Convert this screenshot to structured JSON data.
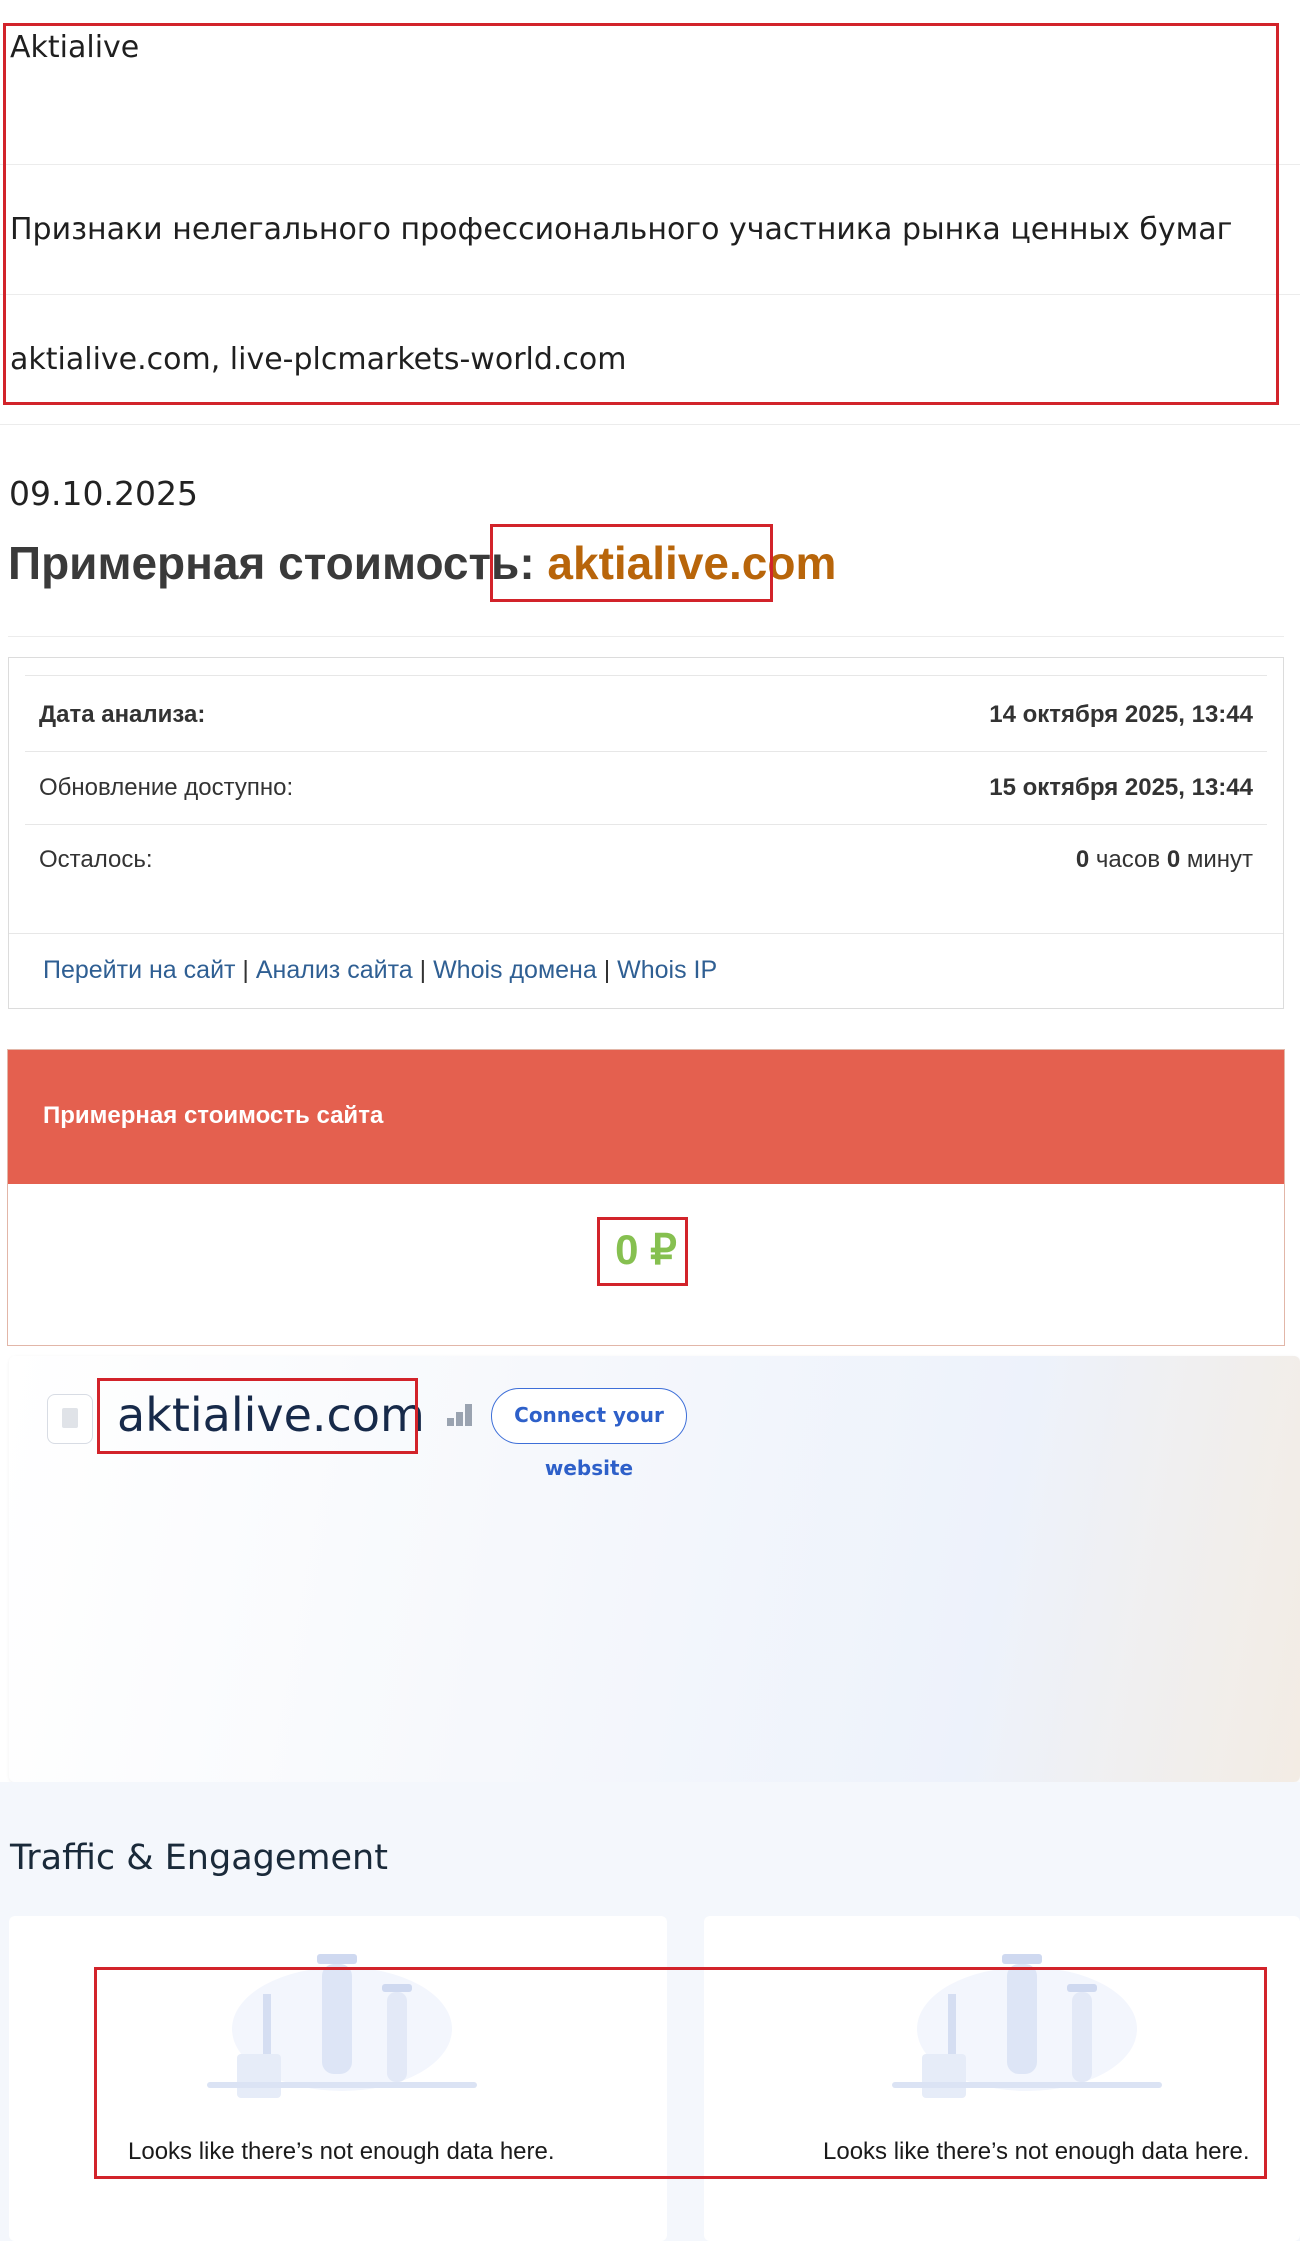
{
  "header": {
    "name": "Aktialive",
    "description": "Признаки нелегального профессионального участника рынка ценных бумаг",
    "domains": "aktialive.com, live-plcmarkets-world.com"
  },
  "date": "09.10.2025",
  "title": {
    "prefix": "Примерная стоимость: ",
    "site": "aktialive.com"
  },
  "analysis": {
    "rows": [
      {
        "label": "Дата анализа:",
        "value": "14 октября 2025, 13:44"
      },
      {
        "label": "Обновление доступно:",
        "value": "15 октября 2025, 13:44"
      },
      {
        "label": "Осталось:",
        "hours_num": "0",
        "hours_word": " часов ",
        "minutes_num": "0",
        "minutes_word": " минут"
      }
    ],
    "links": [
      "Перейти на сайт",
      "Анализ сайта",
      "Whois домена",
      "Whois IP"
    ],
    "separator": " | "
  },
  "value_card": {
    "title": "Примерная стоимость сайта",
    "value": "0 ₽"
  },
  "website": {
    "domain": "aktialive.com",
    "connect_label": "Connect your website"
  },
  "traffic": {
    "title": "Traffic & Engagement",
    "cards": [
      {
        "message": "Looks like there’s not enough data here."
      },
      {
        "message": "Looks like there’s not enough data here."
      }
    ]
  },
  "colors": {
    "highlight_box": "#d2232a",
    "site_accent": "#b8650a",
    "value_header": "#e4604f",
    "value_green": "#86c050",
    "link_blue": "#2f5f93",
    "connect_blue": "#2e60c9"
  }
}
